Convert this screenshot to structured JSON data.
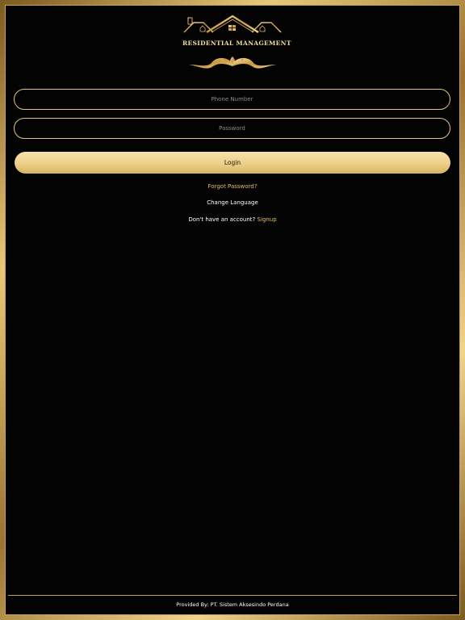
{
  "brand": {
    "title": "RESIDENTIAL MANAGEMENT",
    "gold_color": "#e2c47c",
    "logo_icon": "house-roof-ornament-icon"
  },
  "login_form": {
    "phone_placeholder": "Phone Number",
    "password_placeholder": "Password",
    "login_label": "Login",
    "forgot_password": "Forgot Password?",
    "change_language": "Change Language",
    "no_account_text": "Don't have an account?",
    "signup_link": "Signup"
  },
  "footer": {
    "provided_by": "Provided By: PT. Sistem Aksesindo Perdana"
  }
}
